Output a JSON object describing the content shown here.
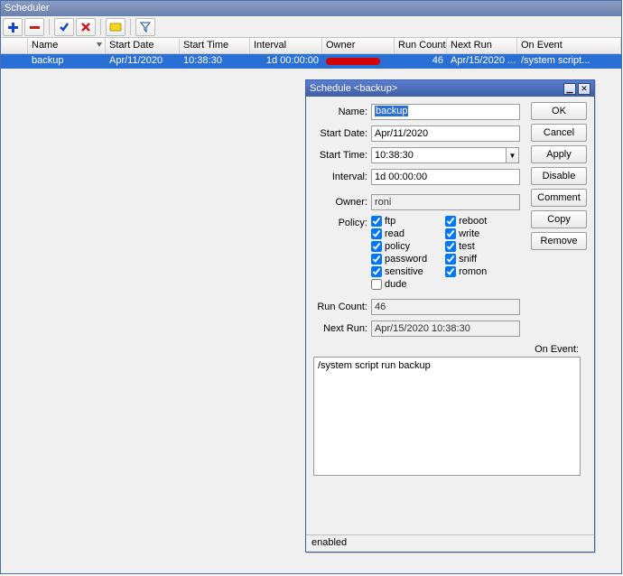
{
  "window": {
    "title": "Scheduler"
  },
  "toolbar_icons": {
    "add": "add-icon",
    "remove": "remove-icon",
    "enable": "enable-icon",
    "disable": "disable-icon",
    "comment": "comment-icon",
    "filter": "filter-icon"
  },
  "columns": {
    "name": "Name",
    "start_date": "Start Date",
    "start_time": "Start Time",
    "interval": "Interval",
    "owner": "Owner",
    "run_count": "Run Count",
    "next_run": "Next Run",
    "on_event": "On Event"
  },
  "rows": [
    {
      "name": "backup",
      "start_date": "Apr/11/2020",
      "start_time": "10:38:30",
      "interval": "1d 00:00:00",
      "owner": "(redacted)",
      "run_count": "46",
      "next_run": "Apr/15/2020 ...",
      "on_event": "/system script..."
    }
  ],
  "child": {
    "title": "Schedule <backup>",
    "labels": {
      "name": "Name:",
      "start_date": "Start Date:",
      "start_time": "Start Time:",
      "interval": "Interval:",
      "owner": "Owner:",
      "policy": "Policy:",
      "run_count": "Run Count:",
      "next_run": "Next Run:",
      "on_event": "On Event:"
    },
    "fields": {
      "name": "backup",
      "start_date": "Apr/11/2020",
      "start_time": "10:38:30",
      "interval": "1d 00:00:00",
      "owner": "roni",
      "run_count": "46",
      "next_run": "Apr/15/2020 10:38:30",
      "on_event": "/system script run backup"
    },
    "policy": {
      "ftp": "ftp",
      "read": "read",
      "policy": "policy",
      "password": "password",
      "sensitive": "sensitive",
      "dude": "dude",
      "reboot": "reboot",
      "write": "write",
      "test": "test",
      "sniff": "sniff",
      "romon": "romon"
    },
    "buttons": {
      "ok": "OK",
      "cancel": "Cancel",
      "apply": "Apply",
      "disable": "Disable",
      "comment": "Comment",
      "copy": "Copy",
      "remove": "Remove"
    },
    "status": "enabled"
  }
}
